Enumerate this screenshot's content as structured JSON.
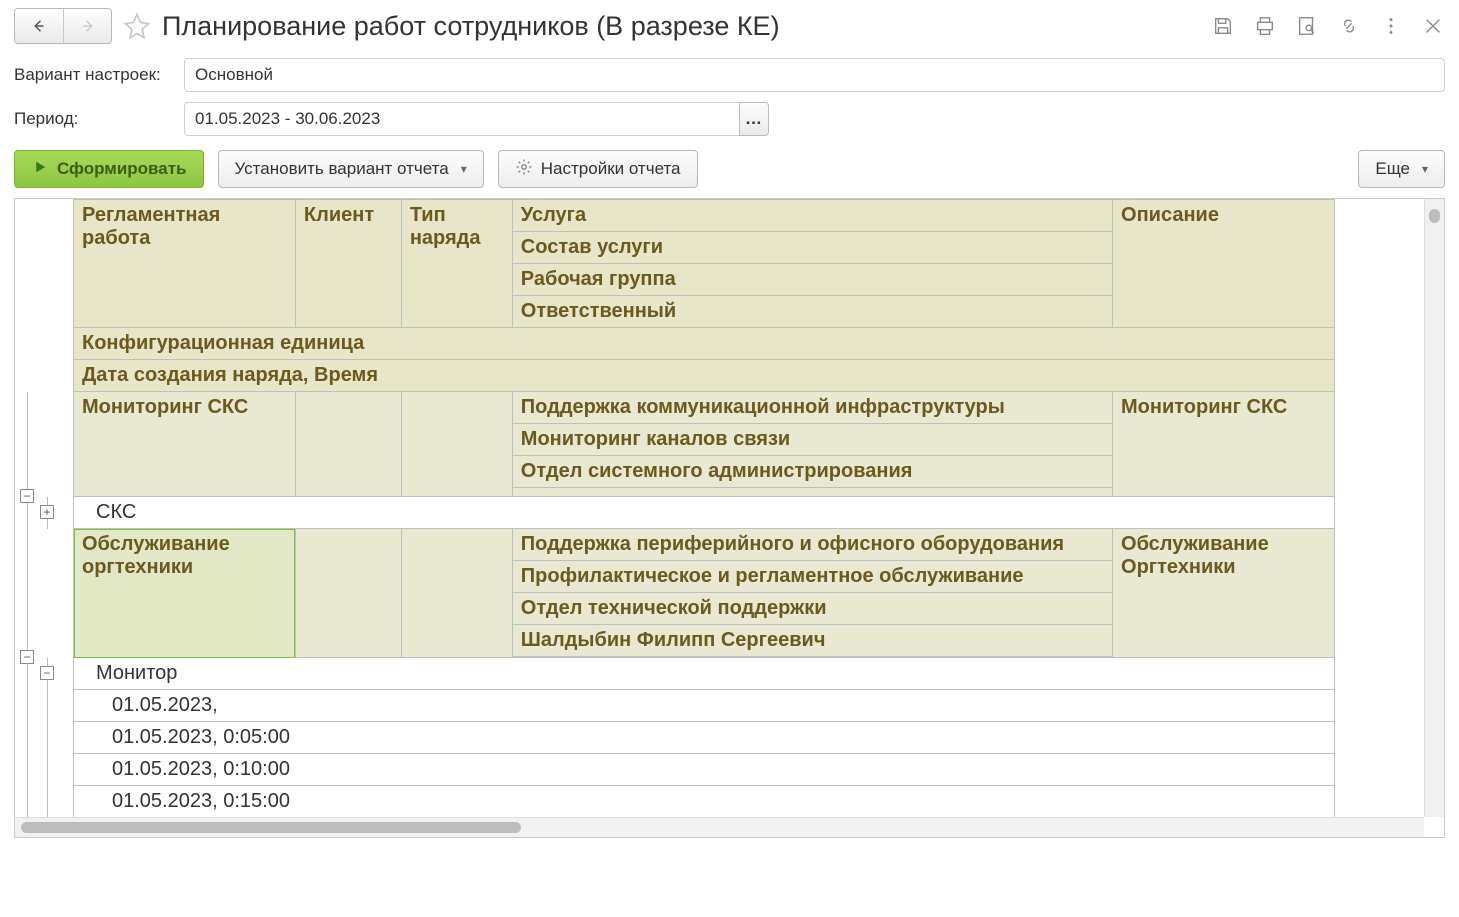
{
  "header": {
    "title": "Планирование работ сотрудников (В разрезе КЕ)"
  },
  "form": {
    "settings_variant_label": "Вариант настроек:",
    "settings_variant_value": "Основной",
    "period_label": "Период:",
    "period_value": "01.05.2023 - 30.06.2023"
  },
  "toolbar": {
    "generate": "Сформировать",
    "set_variant": "Установить вариант отчета",
    "report_settings": "Настройки отчета",
    "more": "Еще"
  },
  "table": {
    "headers": {
      "reg_work": "Регламентная работа",
      "client": "Клиент",
      "order_type": "Тип наряда",
      "service": "Услуга",
      "service_comp": "Состав услуги",
      "work_group": "Рабочая группа",
      "responsible": "Ответственный",
      "description": "Описание",
      "config_unit": "Конфигурационная единица",
      "order_date": "Дата создания наряда, Время"
    },
    "groups": [
      {
        "reg_work": "Мониторинг СКС",
        "service": "Поддержка коммуникационной инфраструктуры",
        "service_comp": "Мониторинг каналов связи",
        "work_group": "Отдел системного администрирования",
        "responsible": "",
        "description": "Мониторинг СКС",
        "child_row": "СКС"
      },
      {
        "reg_work": "Обслуживание оргтехники",
        "service": "Поддержка периферийного и офисного оборудования",
        "service_comp": "Профилактическое и регламентное обслуживание",
        "work_group": "Отдел технической поддержки",
        "responsible": "Шалдыбин Филипп Сергеевич",
        "description": "Обслуживание Оргтехники",
        "child_label": "Монитор",
        "times": [
          "01.05.2023,",
          "01.05.2023, 0:05:00",
          "01.05.2023, 0:10:00",
          "01.05.2023, 0:15:00"
        ]
      }
    ]
  }
}
